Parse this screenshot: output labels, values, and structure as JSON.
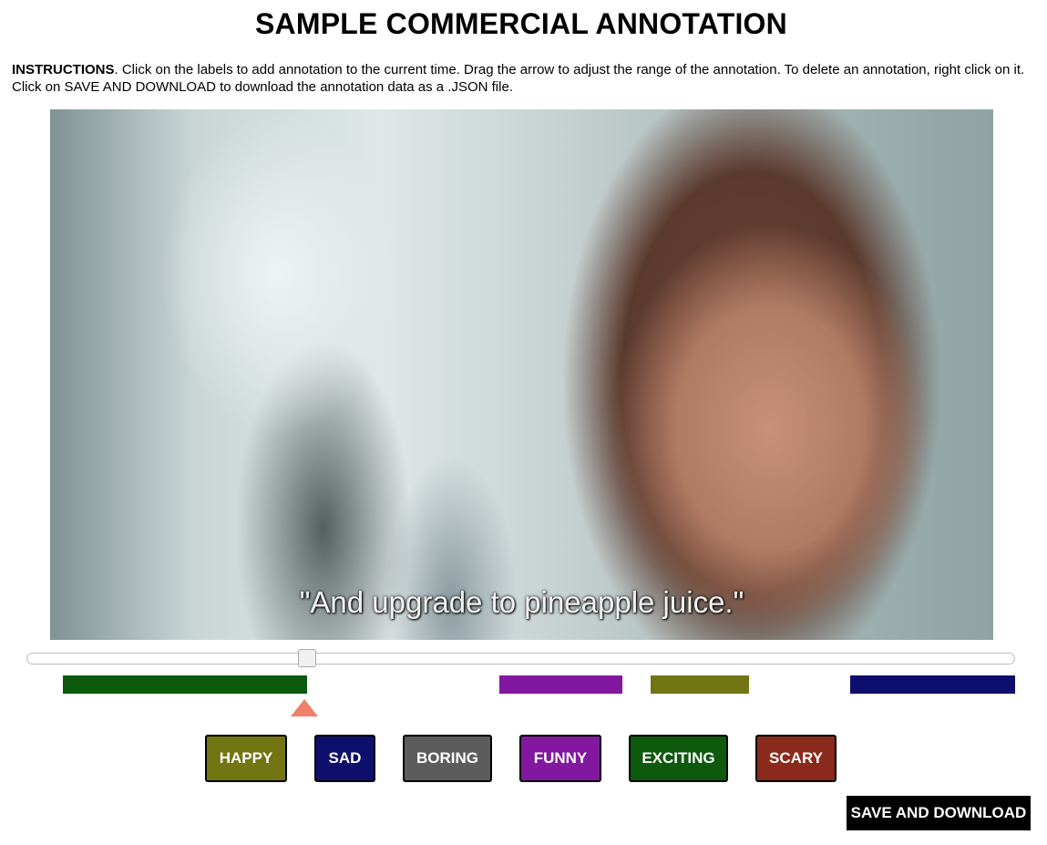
{
  "page": {
    "title": "SAMPLE COMMERCIAL ANNOTATION",
    "instructions_label": "INSTRUCTIONS",
    "instructions_text": ". Click on the labels to add annotation to the current time. Drag the arrow to adjust the range of the annotation. To delete an annotation, right click on it. Click on SAVE AND DOWNLOAD to download the annotation data as a .JSON file."
  },
  "video": {
    "subtitle": "\"And upgrade to pineapple juice.\""
  },
  "timeline": {
    "segments": [
      {
        "label": "EXCITING",
        "color": "#0d5a0d"
      },
      {
        "label": "FUNNY",
        "color": "#8318a0"
      },
      {
        "label": "HAPPY",
        "color": "#727612"
      },
      {
        "label": "SAD",
        "color": "#0e0e6c"
      }
    ],
    "marker_color": "#f0806a"
  },
  "labels": [
    {
      "label": "HAPPY",
      "color": "#727612"
    },
    {
      "label": "SAD",
      "color": "#0e0e6c"
    },
    {
      "label": "BORING",
      "color": "#5c5c5c"
    },
    {
      "label": "FUNNY",
      "color": "#8318a0"
    },
    {
      "label": "EXCITING",
      "color": "#0d5a0d"
    },
    {
      "label": "SCARY",
      "color": "#8a2a1c"
    }
  ],
  "save_button": "SAVE AND DOWNLOAD"
}
